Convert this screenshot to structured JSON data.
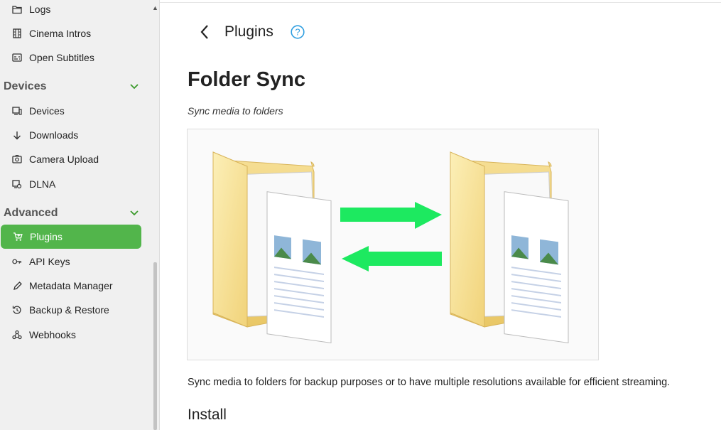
{
  "sidebar": {
    "items_top": [
      {
        "label": "Logs",
        "icon": "folder-icon"
      },
      {
        "label": "Cinema Intros",
        "icon": "film-icon"
      },
      {
        "label": "Open Subtitles",
        "icon": "subtitles-icon"
      }
    ],
    "sections": [
      {
        "title": "Devices",
        "items": [
          {
            "label": "Devices",
            "icon": "devices-icon"
          },
          {
            "label": "Downloads",
            "icon": "download-icon"
          },
          {
            "label": "Camera Upload",
            "icon": "camera-icon"
          },
          {
            "label": "DLNA",
            "icon": "dlna-icon"
          }
        ]
      },
      {
        "title": "Advanced",
        "items": [
          {
            "label": "Plugins",
            "icon": "cart-icon",
            "active": true
          },
          {
            "label": "API Keys",
            "icon": "key-icon"
          },
          {
            "label": "Metadata Manager",
            "icon": "pencil-icon"
          },
          {
            "label": "Backup & Restore",
            "icon": "restore-icon"
          },
          {
            "label": "Webhooks",
            "icon": "webhook-icon"
          }
        ]
      }
    ],
    "active_color": "#52b54b"
  },
  "header": {
    "title": "Plugins"
  },
  "plugin": {
    "name": "Folder Sync",
    "subtitle": "Sync media to folders",
    "description": "Sync media to folders for backup purposes or to have multiple resolutions available for efficient streaming.",
    "install_heading": "Install",
    "arrow_color": "#1de960"
  }
}
